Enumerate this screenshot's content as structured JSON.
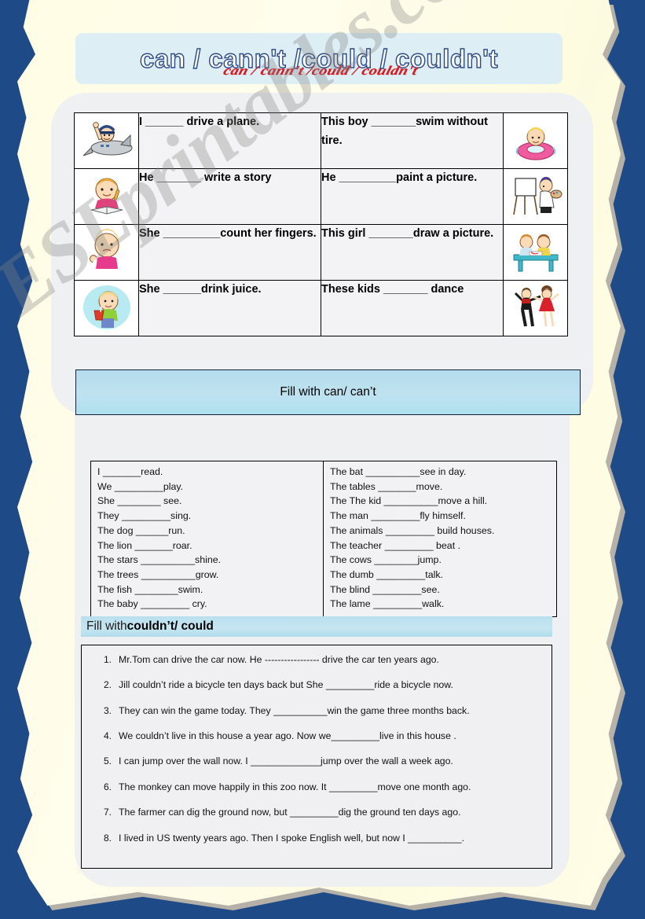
{
  "worksheet": {
    "title_main": "can / cann't /could / couldn't",
    "title_script": "can / cann't /could / couldn't",
    "watermark": "ESLprintables.com",
    "colors": {
      "page_background": "#1e4b87",
      "paper": "#fffde4",
      "paper_shadow": "#b5b1a8",
      "panel": "#eff0f2",
      "banner": "#b3dced",
      "title_box": "#ddeef5",
      "title_outline": "#2c4a86",
      "title_script": "#d81921",
      "border": "#000000"
    }
  },
  "pic_table": {
    "rows": [
      {
        "left_icon": "pilot-plane-icon",
        "left_text": "I ______ drive a plane.",
        "right_text": "This boy _______swim without tire.",
        "right_icon": "swim-ring-boy-icon"
      },
      {
        "left_icon": "boy-reading-book-icon",
        "left_text": "He _______ write a story",
        "right_text": "He _________paint a picture.",
        "right_icon": "painter-easel-icon"
      },
      {
        "left_icon": "girl-counting-fingers-icon",
        "left_text": "She _________count her fingers.",
        "right_text": "This girl _______draw a picture.",
        "right_icon": "kids-drawing-table-icon"
      },
      {
        "left_icon": "boy-drinking-juice-icon",
        "left_text": "She ______drink juice.",
        "right_text": "These kids _______ dance",
        "right_icon": "dancing-couple-icon"
      }
    ]
  },
  "banner_can": {
    "label": "Fill with can/ can’t"
  },
  "practice": {
    "left_column": [
      "I _______read.",
      "We _________play.",
      "She ________ see.",
      "They _________sing.",
      "The dog ______run.",
      "The lion _______roar.",
      "The stars __________shine.",
      "The trees __________grow.",
      "The fish ________swim.",
      "The baby _________ cry."
    ],
    "right_column": [
      "The bat __________see in day.",
      "The tables _______move.",
      "The The kid __________move a hill.",
      "The man _________fly himself.",
      "The animals _________ build houses.",
      "The teacher _________ beat .",
      "The cows ________jump.",
      "The dumb _________talk.",
      "The blind _________see.",
      "The lame _________walk."
    ]
  },
  "banner_could": {
    "prefix": "Fill with ",
    "bold": "couldn’t/ could"
  },
  "numbered": {
    "items": [
      {
        "n": "1.",
        "text": "Mr.Tom  can drive the car now. He ----------------- drive the   car ten years ago."
      },
      {
        "n": "2.",
        "text": "Jill  couldn’t  ride a bicycle ten days back but She _________ride a bicycle now."
      },
      {
        "n": "3.",
        "text": "They can win the game today. They __________win the game three months back."
      },
      {
        "n": "4.",
        "text": "We  couldn’t  live in this house a year ago. Now  we_________live in this house ."
      },
      {
        "n": "5.",
        "text": "I can jump over the wall now. I _____________jump over the wall a week ago."
      },
      {
        "n": "6.",
        "text": "The monkey can move  happily in this zoo now. It _________move one month ago."
      },
      {
        "n": "7.",
        "text": "The farmer can dig the ground now, but _________dig the ground ten days ago."
      },
      {
        "n": "8.",
        "text": "I lived in US twenty years ago. Then I spoke English well, but now I __________."
      }
    ]
  }
}
